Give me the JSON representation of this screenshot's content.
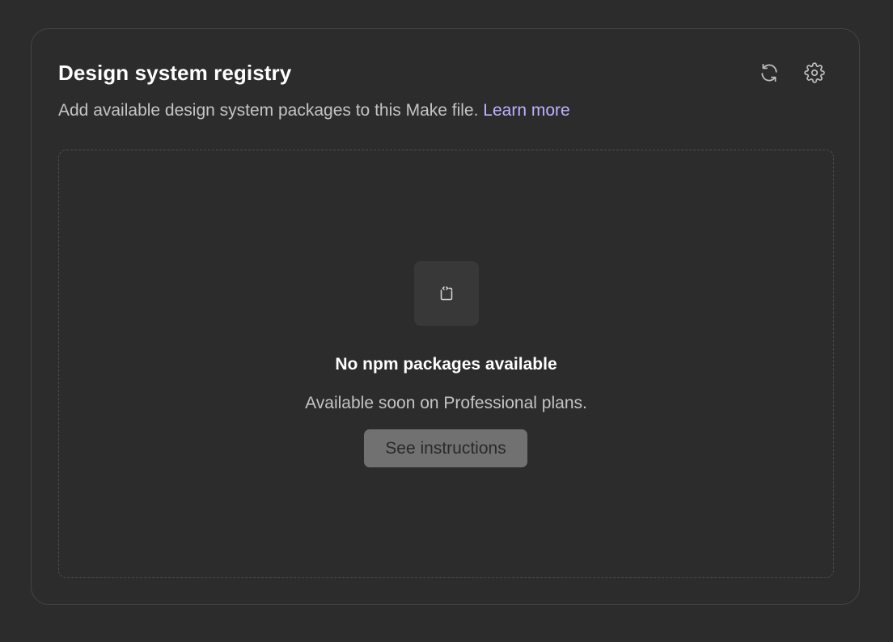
{
  "registry": {
    "title": "Design system registry",
    "description": "Add available design system packages to this Make file.",
    "learn_more_label": "Learn more",
    "refresh_icon": "refresh-icon",
    "settings_icon": "gear-icon"
  },
  "empty_state": {
    "icon": "code-file-icon",
    "title": "No npm packages available",
    "description": "Available soon on Professional plans.",
    "button_label": "See instructions"
  },
  "colors": {
    "background": "#2c2c2c",
    "border": "#444444",
    "link": "#bdb2ff",
    "button_bg": "#717171",
    "icon_box_bg": "#383838"
  }
}
